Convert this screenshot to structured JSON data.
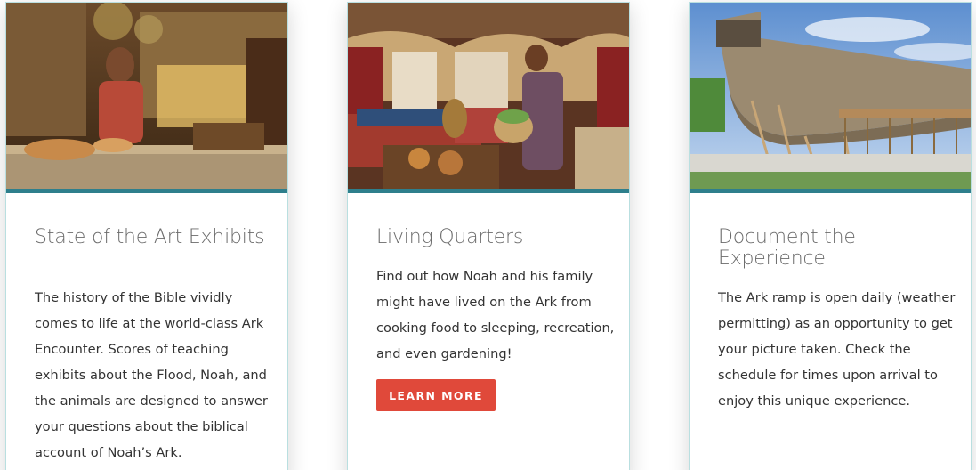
{
  "cards": [
    {
      "title": "State of the Art Exhibits",
      "body": "The history of the Bible vividly comes to life at the world-class Ark Encounter. Scores of teaching exhibits about the Flood, Noah, and the animals are designed to answer your questions about the biblical account of Noah’s Ark."
    },
    {
      "title": "Living Quarters",
      "body": "Find out how Noah and his family might have lived on the Ark from cooking food to sleeping, recreation, and even gardening!",
      "button_label": "LEARN MORE"
    },
    {
      "title": "Document the Experience",
      "body": "The Ark ramp is open daily (weather permitting) as an opportunity to get your picture taken. Check the schedule for times upon arrival to enjoy this unique experience."
    }
  ],
  "colors": {
    "accent_bar": "#2e7f8c",
    "button": "#e0493a",
    "title_text": "#6b6b6b",
    "body_text": "#333333",
    "card_border": "#b9dfe0"
  }
}
